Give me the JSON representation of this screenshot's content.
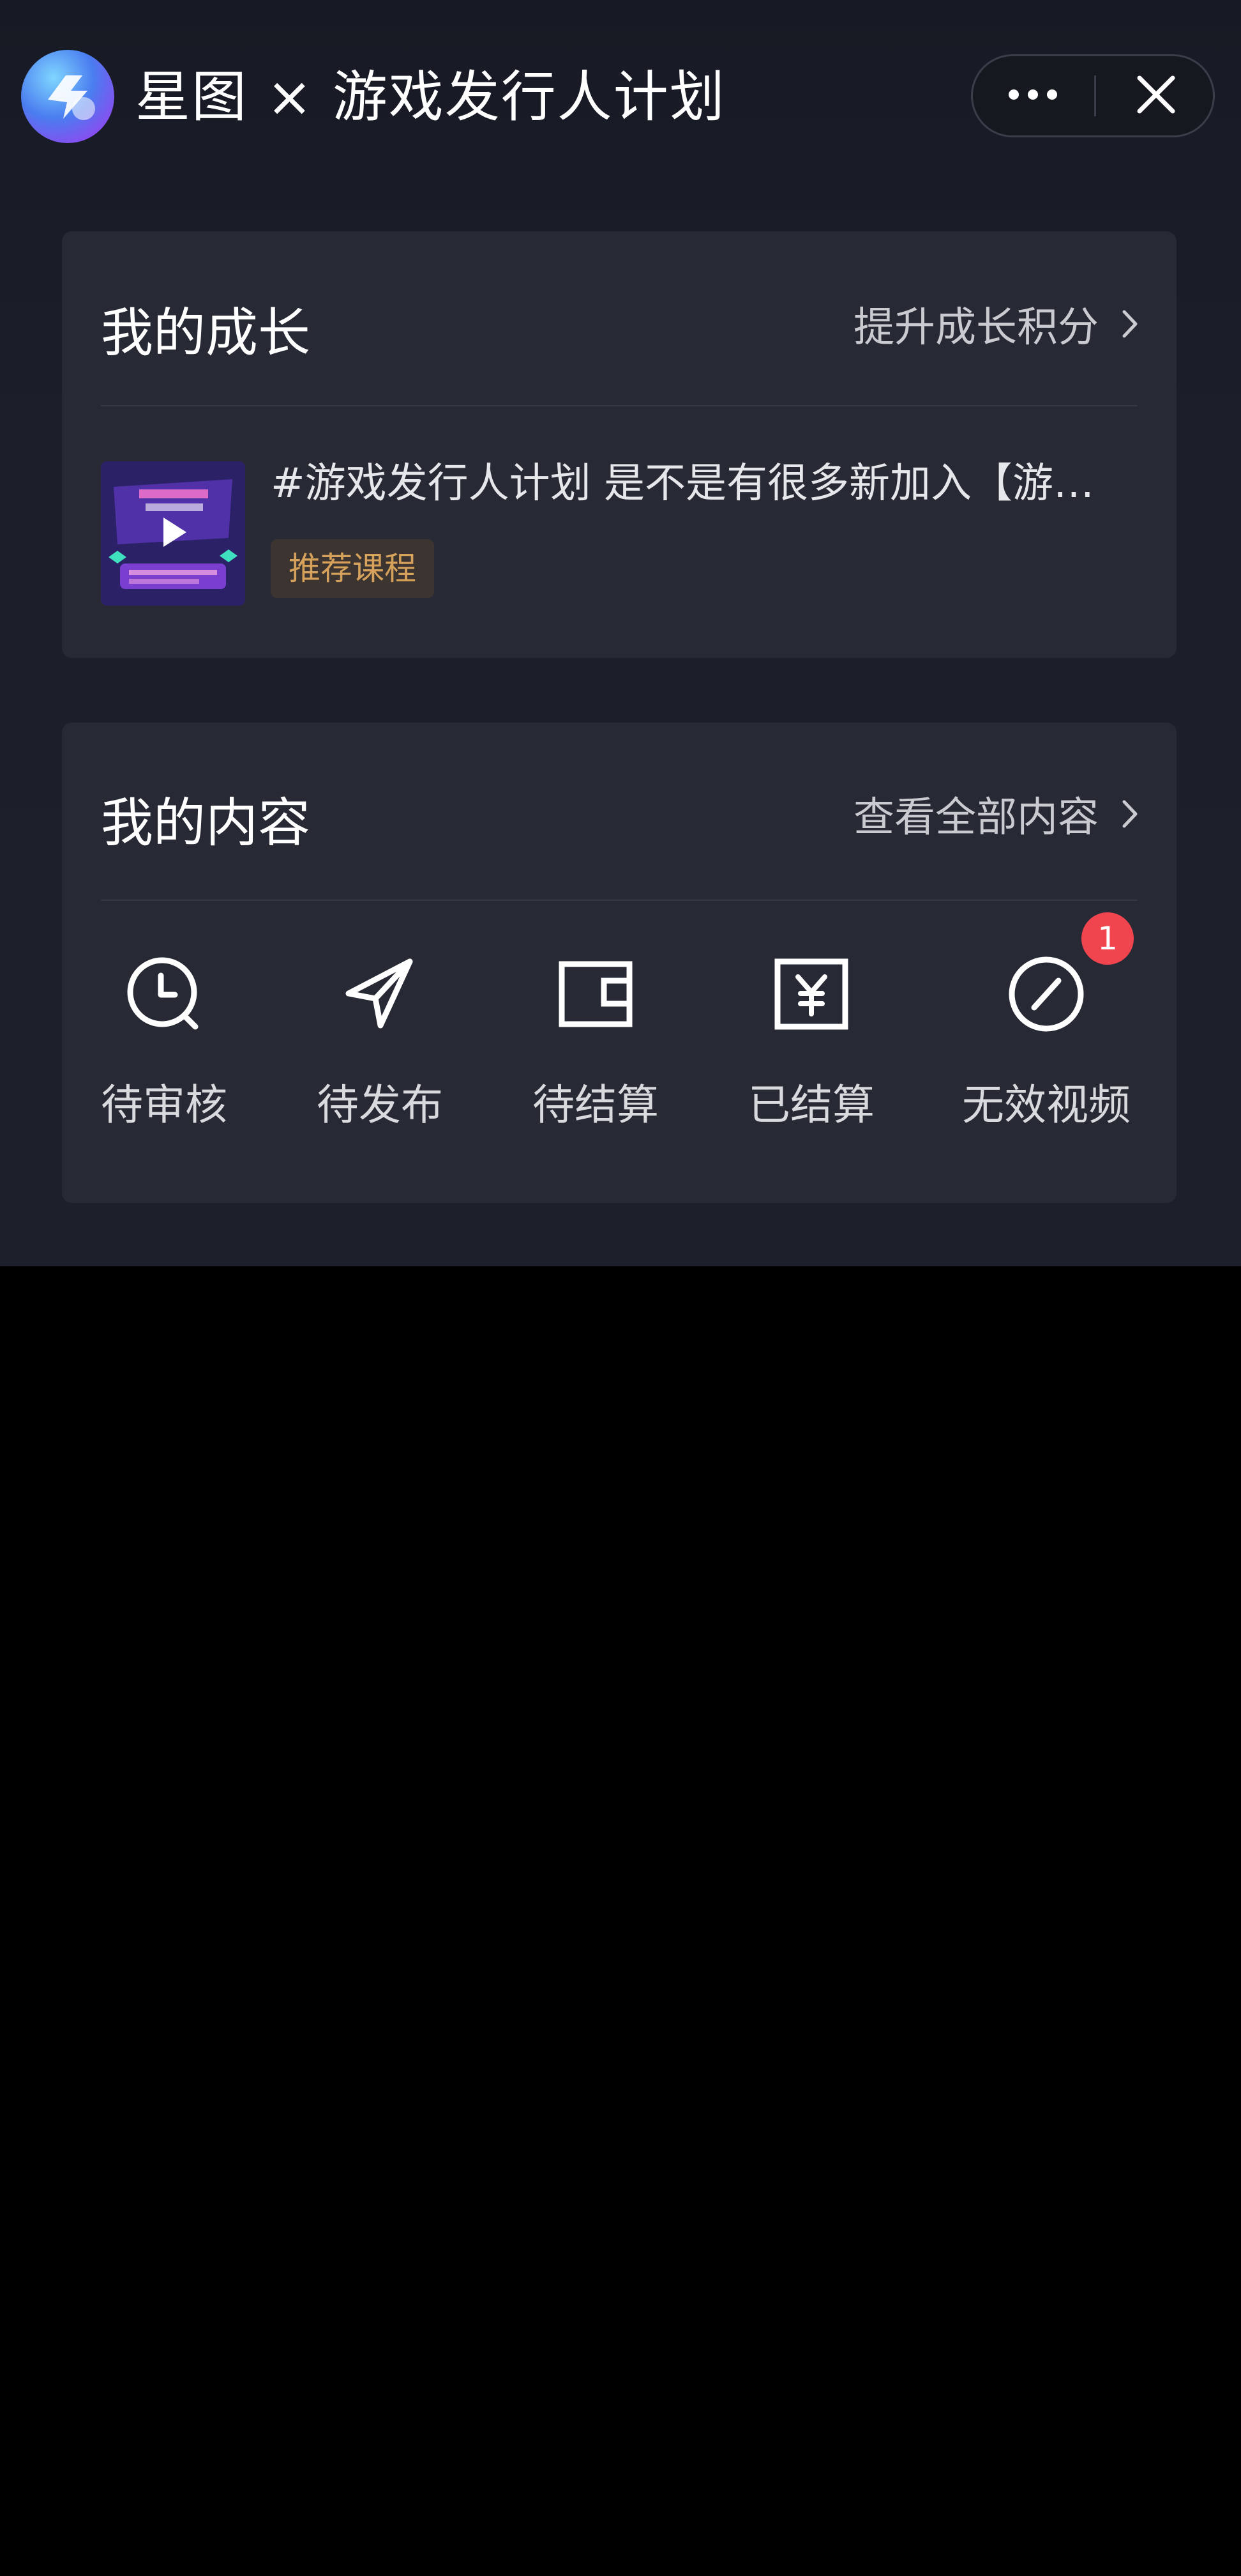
{
  "header": {
    "title": "星图 × 游戏发行人计划",
    "more_icon": "more-dots-icon",
    "close_icon": "close-icon"
  },
  "growth_card": {
    "title": "我的成长",
    "link_label": "提升成长积分",
    "course": {
      "title": "#游戏发行人计划 是不是有很多新加入【游…",
      "tag": "推荐课程",
      "thumbnail_icon": "play-icon"
    }
  },
  "content_card": {
    "title": "我的内容",
    "link_label": "查看全部内容",
    "items": [
      {
        "label": "待审核",
        "icon": "clock-icon"
      },
      {
        "label": "待发布",
        "icon": "paper-plane-icon"
      },
      {
        "label": "待结算",
        "icon": "wallet-icon"
      },
      {
        "label": "已结算",
        "icon": "yuan-icon"
      },
      {
        "label": "无效视频",
        "icon": "prohibited-icon",
        "badge": "1"
      }
    ]
  },
  "colors": {
    "panel_bg": "#1c1f2a",
    "card_bg": "#272a35",
    "tag_text": "#d6a15a",
    "badge": "#f0444f"
  }
}
